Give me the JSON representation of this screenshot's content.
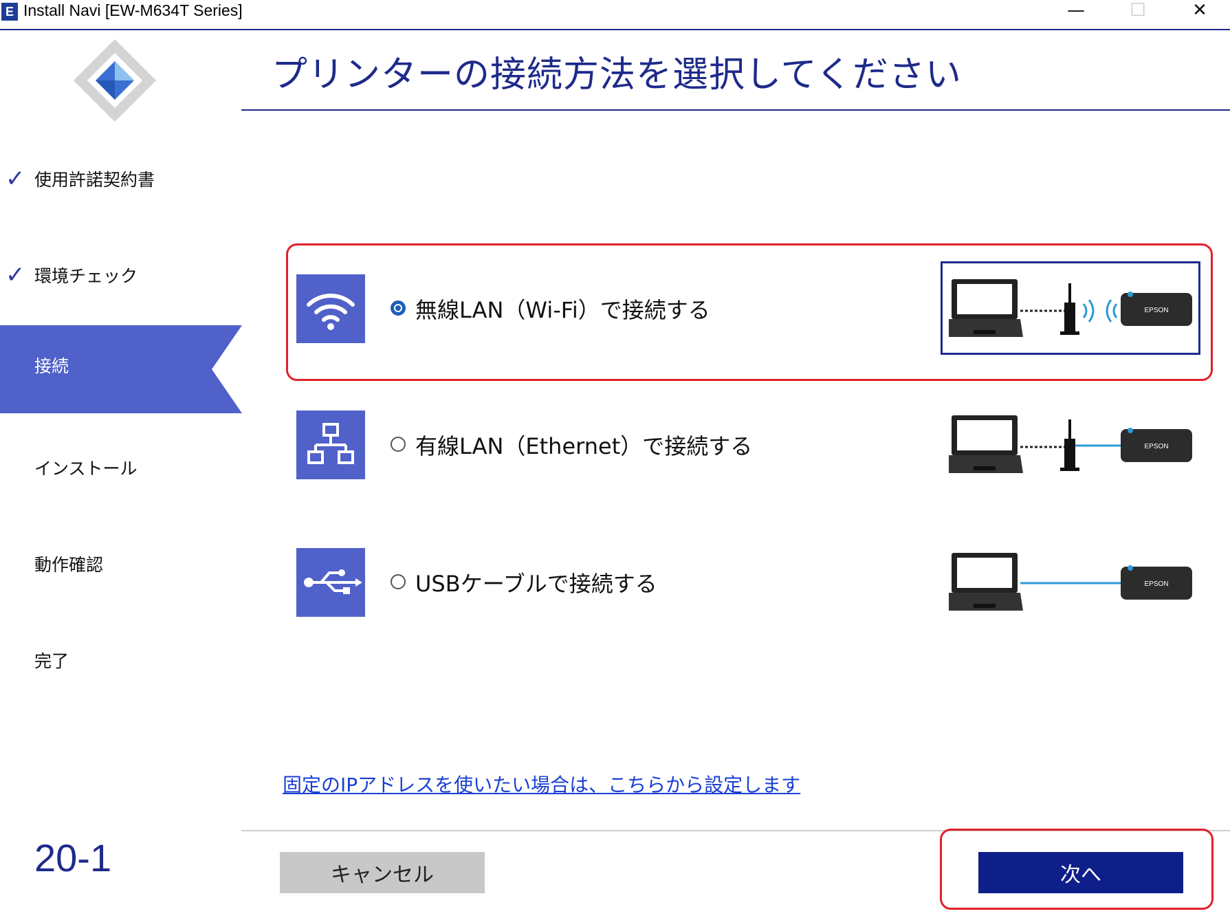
{
  "window": {
    "app_icon_letter": "E",
    "title": "Install Navi [EW-M634T Series]",
    "minimize": "—",
    "maximize": "☐",
    "close": "✕"
  },
  "sidebar": {
    "steps": [
      {
        "label": "使用許諾契約書",
        "check": "✓",
        "state": "done"
      },
      {
        "label": "環境チェック",
        "check": "✓",
        "state": "done"
      },
      {
        "label": "接続",
        "state": "current"
      },
      {
        "label": "インストール",
        "state": "pending"
      },
      {
        "label": "動作確認",
        "state": "pending"
      },
      {
        "label": "完了",
        "state": "pending"
      }
    ],
    "page_number": "20-1"
  },
  "main": {
    "title": "プリンターの接続方法を選択してください",
    "options": [
      {
        "label": "無線LAN（Wi-Fi）で接続する",
        "icon": "wifi-icon",
        "selected": true,
        "printer_brand": "EPSON"
      },
      {
        "label": "有線LAN（Ethernet）で接続する",
        "icon": "network-icon",
        "selected": false,
        "printer_brand": "EPSON"
      },
      {
        "label": "USBケーブルで接続する",
        "icon": "usb-icon",
        "selected": false,
        "printer_brand": "EPSON"
      }
    ],
    "ip_link": "固定のIPアドレスを使いたい場合は、こちらから設定します"
  },
  "footer": {
    "cancel_label": "キャンセル",
    "next_label": "次へ"
  },
  "colors": {
    "accent": "#5061c9",
    "navy": "#1e2a8a",
    "highlight": "#e0202a",
    "link": "#1a3fd4",
    "cable": "#2a9ad6"
  }
}
